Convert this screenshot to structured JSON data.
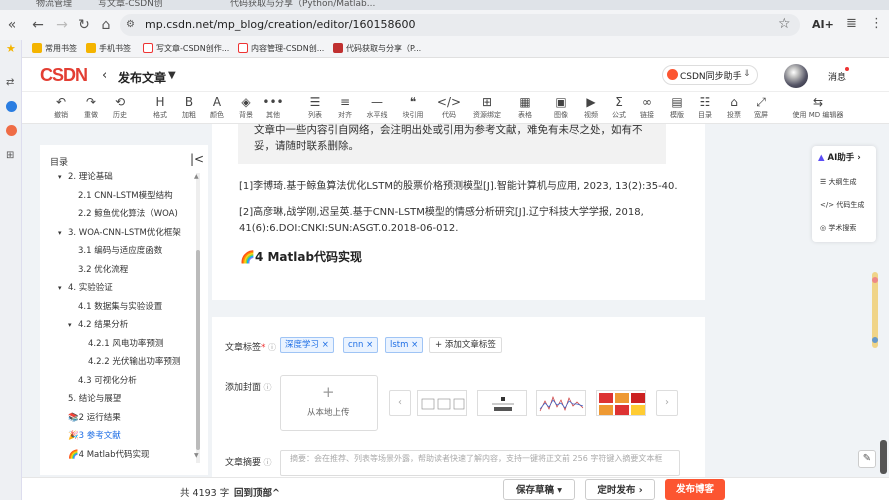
{
  "browser": {
    "tabs": [
      "物流管理",
      "写文章-CSDN创作中心",
      "代码获取与分享（Python/Matlab..."
    ],
    "url": "mp.csdn.net/mp_blog/creation/editor/160158600",
    "ai_label": "AI+",
    "bookmarks": [
      "常用书签",
      "手机书签",
      "写文章-CSDN创作...",
      "内容管理-CSDN创...",
      "代码获取与分享（P..."
    ]
  },
  "header": {
    "logo": "CSDN",
    "title": "发布文章",
    "sync_label": "CSDN同步助手",
    "messages": "消息"
  },
  "toolbar": [
    {
      "icon": "undo-icon",
      "glyph": "↶",
      "label": "撤销"
    },
    {
      "icon": "redo-icon",
      "glyph": "↷",
      "label": "重做"
    },
    {
      "icon": "history-icon",
      "glyph": "⟲",
      "label": "历史"
    },
    {
      "icon": "heading-icon",
      "glyph": "H",
      "label": "格式"
    },
    {
      "icon": "bold-icon",
      "glyph": "B",
      "label": "加粗"
    },
    {
      "icon": "font-color-icon",
      "glyph": "A",
      "label": "颜色"
    },
    {
      "icon": "background-color-icon",
      "glyph": "◈",
      "label": "背景"
    },
    {
      "icon": "more-icon",
      "glyph": "•••",
      "label": "其他"
    },
    {
      "icon": "list-icon",
      "glyph": "☰",
      "label": "列表"
    },
    {
      "icon": "align-icon",
      "glyph": "≡",
      "label": "对齐"
    },
    {
      "icon": "horizontal-rule-icon",
      "glyph": "—",
      "label": "水平线"
    },
    {
      "icon": "blockquote-icon",
      "glyph": "❝",
      "label": "块引用"
    },
    {
      "icon": "code-icon",
      "glyph": "</>",
      "label": "代码"
    },
    {
      "icon": "resource-bind-icon",
      "glyph": "⊞",
      "label": "资源绑定"
    },
    {
      "icon": "table-icon",
      "glyph": "▦",
      "label": "表格"
    },
    {
      "icon": "image-icon",
      "glyph": "▣",
      "label": "图像"
    },
    {
      "icon": "video-icon",
      "glyph": "▶",
      "label": "视频"
    },
    {
      "icon": "formula-icon",
      "glyph": "Σ",
      "label": "公式"
    },
    {
      "icon": "link-icon",
      "glyph": "∞",
      "label": "链接"
    },
    {
      "icon": "template-icon",
      "glyph": "▤",
      "label": "模版"
    },
    {
      "icon": "toc-icon",
      "glyph": "☷",
      "label": "目录"
    },
    {
      "icon": "vote-icon",
      "glyph": "⌂",
      "label": "投票"
    },
    {
      "icon": "wide-screen-icon",
      "glyph": "⤢",
      "label": "宽屏"
    },
    {
      "icon": "md-editor-icon",
      "glyph": "⇆",
      "label": "使用 MD 编辑器"
    }
  ],
  "toc": {
    "title": "目录",
    "items": [
      {
        "text": "2. 理论基础",
        "indent": 0,
        "toggle": "▾"
      },
      {
        "text": "2.1 CNN-LSTM模型结构",
        "indent": 1,
        "toggle": ""
      },
      {
        "text": "2.2 鲸鱼优化算法（WOA)",
        "indent": 1,
        "toggle": ""
      },
      {
        "text": "3. WOA-CNN-LSTM优化框架",
        "indent": 0,
        "toggle": "▾"
      },
      {
        "text": "3.1 编码与适应度函数",
        "indent": 1,
        "toggle": ""
      },
      {
        "text": "3.2 优化流程",
        "indent": 1,
        "toggle": ""
      },
      {
        "text": "4. 实验验证",
        "indent": 0,
        "toggle": "▾"
      },
      {
        "text": "4.1 数据集与实验设置",
        "indent": 1,
        "toggle": ""
      },
      {
        "text": "4.2 结果分析",
        "indent": 1,
        "toggle": "▾"
      },
      {
        "text": "4.2.1 风电功率预测",
        "indent": 2,
        "toggle": ""
      },
      {
        "text": "4.2.2 光伏输出功率预测",
        "indent": 2,
        "toggle": ""
      },
      {
        "text": "4.3 可视化分析",
        "indent": 1,
        "toggle": ""
      },
      {
        "text": "5. 结论与展望",
        "indent": 0,
        "toggle": ""
      },
      {
        "text": "📚2 运行结果",
        "indent": 0,
        "toggle": ""
      },
      {
        "text": "🎉3 参考文献",
        "indent": 0,
        "toggle": ""
      },
      {
        "text": "🌈4 Matlab代码实现",
        "indent": 0,
        "toggle": ""
      }
    ]
  },
  "editor": {
    "quote": "文章中一些内容引自网络，会注明出处或引用为参考文献，难免有未尽之处，如有不妥，请随时联系删除。",
    "references": [
      "[1]李博琦.基于鲸鱼算法优化LSTM的股票价格预测模型[J].智能计算机与应用, 2023, 13(2):35-40.",
      "[2]高彦琳,战学刚,迟呈英.基于CNN-LSTM模型的情感分析研究[J].辽宁科技大学学报, 2018, 41(6):6.DOI:CNKI:SUN:ASGT.0.2018-06-012."
    ],
    "heading": "🌈4 Matlab代码实现"
  },
  "form": {
    "tags_label": "文章标签",
    "tags": [
      "深度学习",
      "cnn",
      "lstm"
    ],
    "add_tag": "添加文章标签",
    "cover_label": "添加封面",
    "cover_upload": "从本地上传",
    "summary_label": "文章摘要",
    "summary_placeholder": "摘要：会在推荐、列表等场景外露，帮助读者快速了解内容，支持一键将正文前 256 字符键入摘要文本框"
  },
  "bottom": {
    "word_count": "共 4193 字",
    "to_top": "回到顶部",
    "save_draft": "保存草稿",
    "schedule": "定时发布",
    "publish": "发布博客"
  },
  "ai_panel": {
    "title": "AI助手",
    "items": [
      "大纲生成",
      "代码生成",
      "学术搜索"
    ]
  },
  "colors": {
    "brand": "#fc5531",
    "link": "#1f6fe5"
  }
}
